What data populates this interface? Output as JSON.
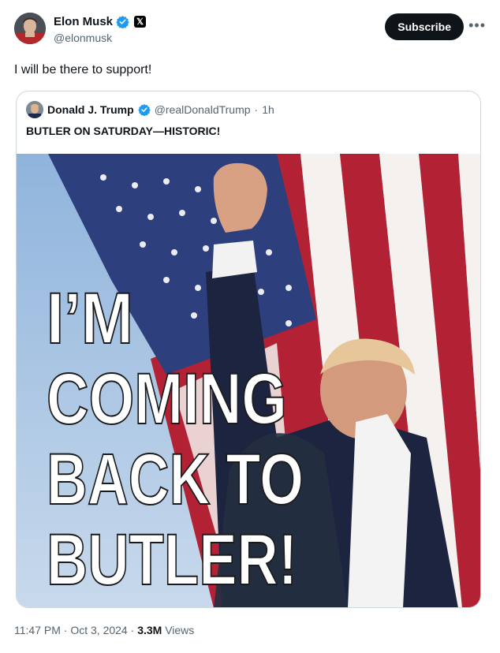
{
  "author": {
    "name": "Elon Musk",
    "handle": "@elonmusk"
  },
  "header": {
    "subscribe_label": "Subscribe",
    "more_label": "•••"
  },
  "tweet": {
    "text": "I will be there to support!"
  },
  "quoted": {
    "name": "Donald J. Trump",
    "handle": "@realDonaldTrump",
    "time": "1h",
    "text": "BUTLER ON SATURDAY—HISTORIC!",
    "image_text": {
      "line1": "I’M",
      "line2": "COMING",
      "line3": "BACK TO",
      "line4": "BUTLER!"
    }
  },
  "footer": {
    "time": "11:47 PM",
    "date": "Oct 3, 2024",
    "views_count": "3.3M",
    "views_label": "Views"
  },
  "colors": {
    "verified": "#1d9bf0",
    "flag_red": "#b22234",
    "flag_blue": "#3c3b6e",
    "text_primary": "#0f1419",
    "text_secondary": "#536471"
  }
}
